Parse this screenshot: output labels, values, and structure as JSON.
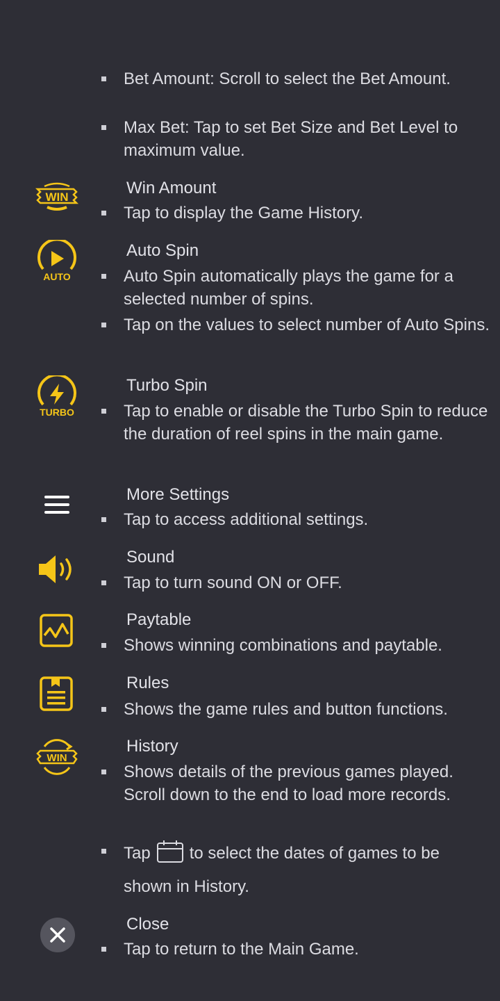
{
  "colors": {
    "background": "#2e2e36",
    "accent": "#f5c518",
    "text": "#dcdce2"
  },
  "bet_section": {
    "bullets": [
      "Bet Amount: Scroll to select the Bet Amount.",
      "Max Bet: Tap to set Bet Size and Bet Level to maximum value."
    ]
  },
  "sections": [
    {
      "icon": "win-badge-icon",
      "icon_text": "WIN",
      "title": "Win Amount",
      "bullets": [
        "Tap to display the Game History."
      ]
    },
    {
      "icon": "auto-spin-icon",
      "icon_text": "AUTO",
      "title": "Auto Spin",
      "bullets": [
        "Auto Spin automatically plays the game for a selected number of spins.",
        "Tap on the values to select number of Auto Spins."
      ]
    },
    {
      "icon": "turbo-spin-icon",
      "icon_text": "TURBO",
      "title": "Turbo Spin",
      "bullets": [
        "Tap to enable or disable the Turbo Spin to reduce the duration of reel spins in the main game."
      ]
    },
    {
      "icon": "menu-icon",
      "title": "More Settings",
      "bullets": [
        "Tap to access additional settings."
      ]
    },
    {
      "icon": "sound-icon",
      "title": "Sound",
      "bullets": [
        "Tap to turn sound ON or OFF."
      ]
    },
    {
      "icon": "paytable-icon",
      "title": "Paytable",
      "bullets": [
        "Shows winning combinations and paytable."
      ]
    },
    {
      "icon": "rules-icon",
      "title": "Rules",
      "bullets": [
        "Shows the game rules and button functions."
      ]
    },
    {
      "icon": "history-icon",
      "icon_text": "WIN",
      "title": "History",
      "bullets": [
        "Shows details of the previous games played. Scroll down to the end to load more records."
      ],
      "tap_prefix": "Tap",
      "tap_suffix": "to select the dates of games to be",
      "tap_line2": "shown in History."
    },
    {
      "icon": "close-icon",
      "title": "Close",
      "bullets": [
        "Tap to return to the Main Game."
      ]
    }
  ]
}
